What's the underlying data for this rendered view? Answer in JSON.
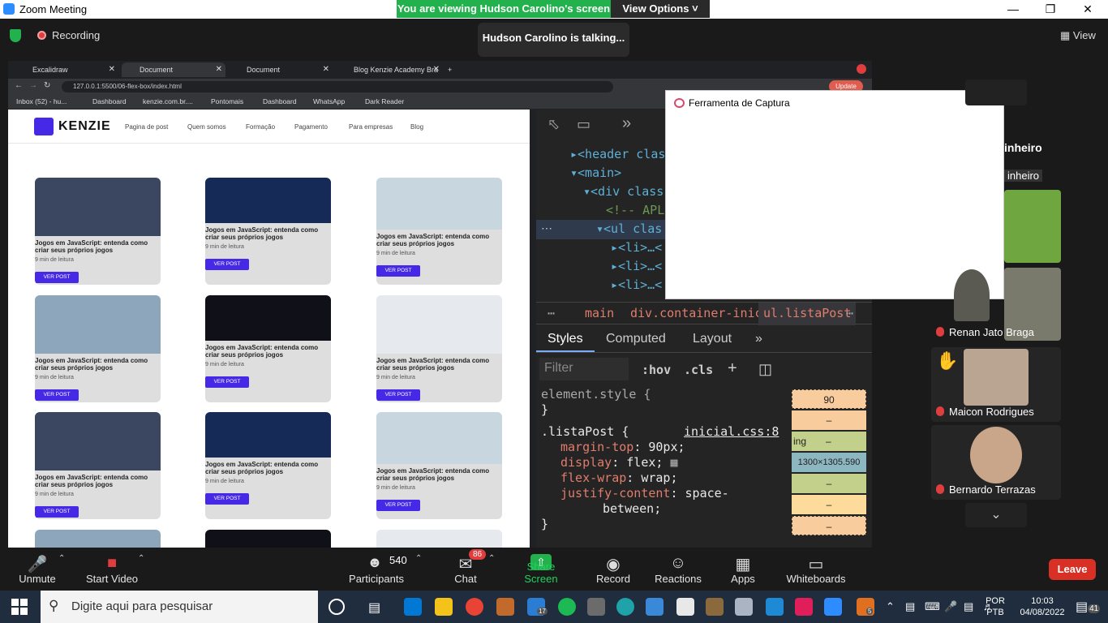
{
  "zoom": {
    "window_title": "Zoom Meeting",
    "view_banner": "You are viewing Hudson Carolino's screen",
    "view_options": "View Options",
    "talking": "Hudson Carolino is talking...",
    "recording": "Recording",
    "view_button": "View",
    "leave": "Leave"
  },
  "browser": {
    "tabs": [
      {
        "label": "Excalidraw"
      },
      {
        "label": "Document"
      },
      {
        "label": "Document"
      },
      {
        "label": "Blog Kenzie Academy Bra"
      }
    ],
    "url": "127.0.0.1:5500/06-flex-box/index.html",
    "update": "Update",
    "bookmarks": [
      "Inbox (52) - hu...",
      "Dashboard",
      "kenzie.com.br....",
      "Pontomais",
      "Dashboard",
      "WhatsApp",
      "Dark Reader"
    ]
  },
  "site": {
    "logo": "KENZIE",
    "nav": [
      "Pagina de post",
      "Quem somos",
      "Formação",
      "Pagamento",
      "Para empresas",
      "Blog"
    ],
    "card_title": "Jogos em JavaScript: entenda como criar seus próprios jogos",
    "card_read": "9 min de leitura",
    "card_button": "VER POST"
  },
  "devtools": {
    "elements": [
      "<header clas",
      "<main>",
      "<div class",
      "<!-- APL",
      "<ul clas",
      "<li>…<",
      "<li>…<",
      "<li>…<"
    ],
    "breadcrumbs": [
      "main",
      "div.container-inicial",
      "ul.listaPost"
    ],
    "tabs": [
      "Styles",
      "Computed",
      "Layout"
    ],
    "filter_placeholder": "Filter",
    "hov": ":hov",
    "cls": ".cls",
    "element_style": "element.style {",
    "close_brace": "}",
    "rule_selector": ".listaPost {",
    "rule_source": "inicial.css:8",
    "declarations": [
      {
        "prop": "margin-top",
        "value": "90px;"
      },
      {
        "prop": "display",
        "value": "flex;"
      },
      {
        "prop": "flex-wrap",
        "value": "wrap;"
      },
      {
        "prop": "justify-content",
        "value": "space-"
      }
    ],
    "decl_cont": "between;",
    "box_model": [
      "90",
      "–",
      "–",
      "1300×1305.590",
      "–",
      "–",
      "–"
    ],
    "box_label": "ing"
  },
  "snip": {
    "title": "Ferramenta de Captura"
  },
  "participants": [
    {
      "name": "inheiro"
    },
    {
      "name": "Renan Jato Braga"
    },
    {
      "name": "Maicon Rodrigues"
    },
    {
      "name": "Bernardo Terrazas"
    }
  ],
  "participant_header": "inheiro",
  "toolbar": {
    "unmute": "Unmute",
    "start_video": "Start Video",
    "participants_count": "540",
    "participants": "Participants",
    "chat_badge": "86",
    "chat": "Chat",
    "share": "Share Screen",
    "record": "Record",
    "reactions": "Reactions",
    "apps": "Apps",
    "whiteboards": "Whiteboards"
  },
  "taskbar": {
    "search_placeholder": "Digite aqui para pesquisar",
    "lang1": "POR",
    "lang2": "PTB",
    "time": "10:03",
    "date": "04/08/2022",
    "notif": "41",
    "badge17": "17",
    "badge5": "5"
  }
}
